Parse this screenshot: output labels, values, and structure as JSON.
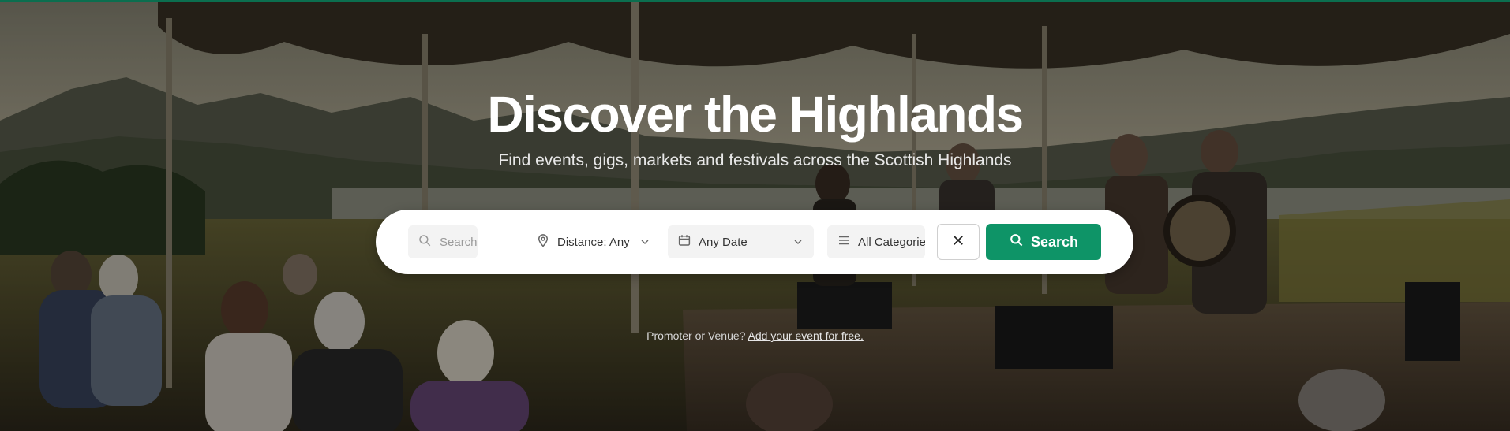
{
  "hero": {
    "title": "Discover the Highlands",
    "subtitle": "Find events, gigs, markets and festivals across the Scottish Highlands"
  },
  "search": {
    "placeholder": "Search events...",
    "distance_label": "Distance: Any",
    "date_label": "Any Date",
    "category_label": "All Categories",
    "search_button": "Search",
    "icons": [
      "search-icon",
      "map-pin-icon",
      "calendar-icon",
      "list-icon",
      "close-icon",
      "chevron-down-icon"
    ]
  },
  "promoter": {
    "text": "Promoter or Venue?",
    "link": "Add your event for free."
  },
  "colors": {
    "accent": "#0e9467",
    "top_bar": "#0b6e4f",
    "text_white": "#ffffff"
  }
}
